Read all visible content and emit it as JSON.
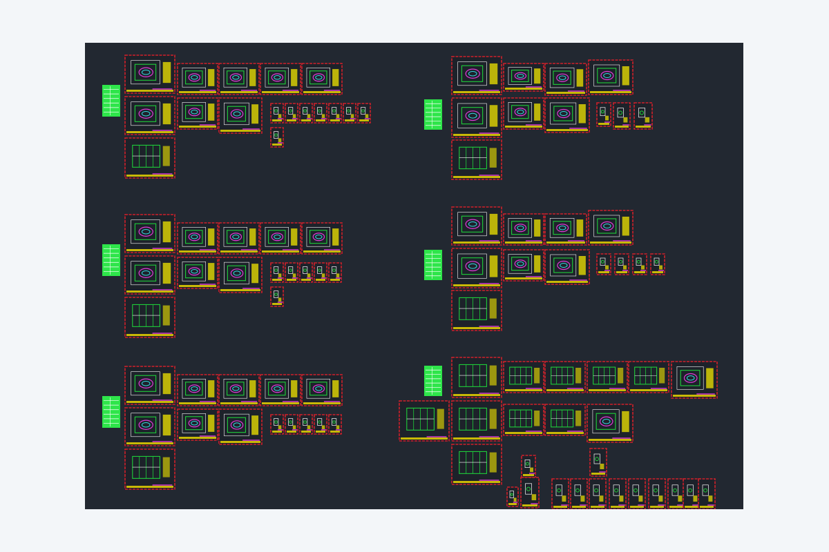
{
  "canvas": {
    "background": "#222831",
    "page_background": "#f3f6f9"
  },
  "colors": {
    "sheet_border": "#d0202a",
    "sheet_fill": "#1d222a",
    "title_block": "#e8d400",
    "linework_primary": "#1fcf3a",
    "linework_secondary": "#ffffff",
    "accent_magenta": "#e03ad8",
    "accent_cyan": "#35d9e6",
    "accent_yellow": "#f2e600",
    "table_green": "#2ee54a"
  },
  "sheet_types": [
    "plan",
    "section",
    "detail",
    "table"
  ]
}
